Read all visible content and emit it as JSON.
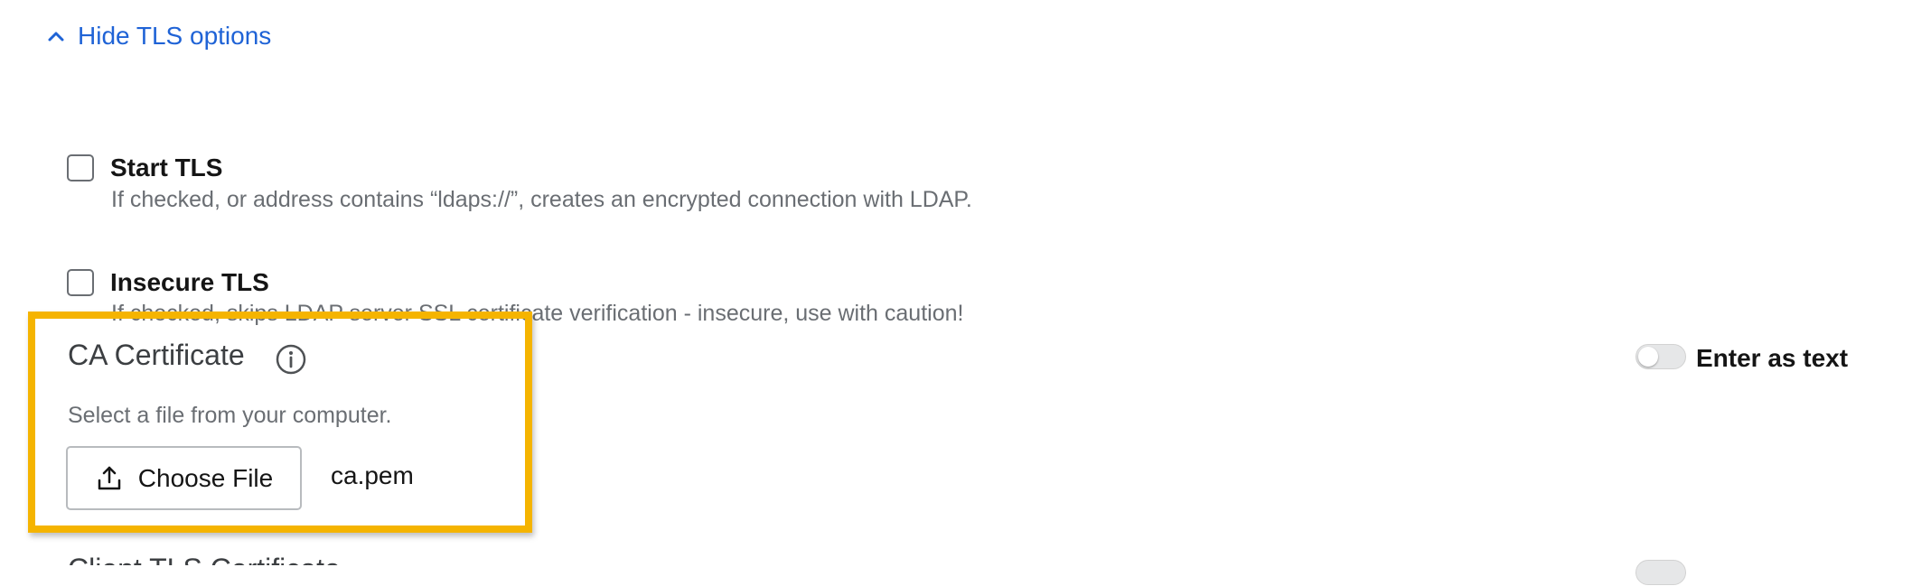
{
  "tls_toggle": {
    "label": "Hide TLS options",
    "icon": "chevron-up-icon",
    "color": "#1f63d6"
  },
  "options": [
    {
      "label": "Start TLS",
      "checked": false,
      "help": "If checked, or address contains “ldaps://”, creates an encrypted connection with LDAP."
    },
    {
      "label": "Insecure TLS",
      "checked": false,
      "help": "If checked, skips LDAP server SSL certificate verification - insecure, use with caution!"
    }
  ],
  "ca_certificate": {
    "title": "CA Certificate",
    "info_icon": "info-icon",
    "help": "Select a file from your computer.",
    "choose_button": {
      "label": "Choose File",
      "icon": "upload-icon"
    },
    "file_name": "ca.pem",
    "enter_as_text": {
      "label": "Enter as text",
      "on": false
    },
    "highlight_color": "#f5b400"
  },
  "next_section": {
    "title": "Client TLS Certificate"
  }
}
